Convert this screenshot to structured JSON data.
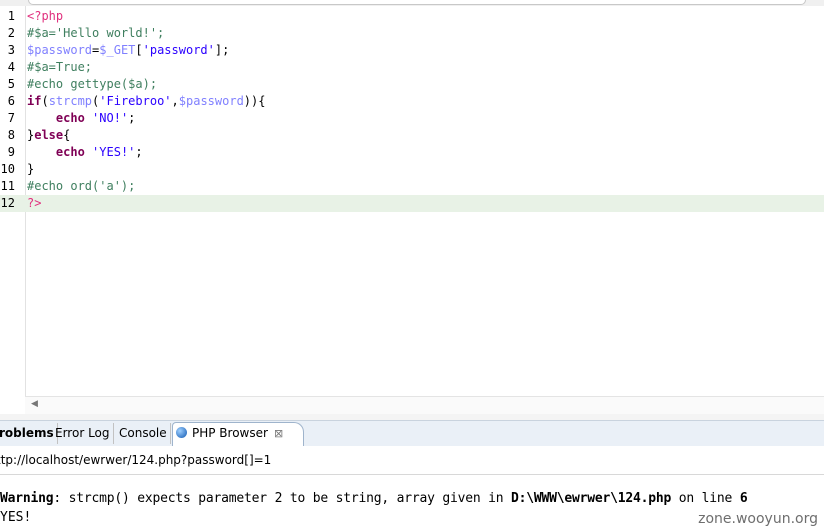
{
  "editor": {
    "line_numbers": [
      "1",
      "2",
      "3",
      "4",
      "5",
      "6",
      "7",
      "8",
      "9",
      "10",
      "11",
      "12"
    ],
    "lines": [
      [
        {
          "c": "tag",
          "t": "<?php"
        }
      ],
      [
        {
          "c": "comment",
          "t": "#$a='Hello world!';"
        }
      ],
      [
        {
          "c": "var",
          "t": "$password"
        },
        {
          "c": "plain",
          "t": "="
        },
        {
          "c": "var",
          "t": "$_GET"
        },
        {
          "c": "plain",
          "t": "["
        },
        {
          "c": "str",
          "t": "'password'"
        },
        {
          "c": "plain",
          "t": "];"
        }
      ],
      [
        {
          "c": "comment",
          "t": "#$a=True;"
        }
      ],
      [
        {
          "c": "comment",
          "t": "#echo gettype($a);"
        }
      ],
      [
        {
          "c": "kw",
          "t": "if"
        },
        {
          "c": "plain",
          "t": "("
        },
        {
          "c": "var",
          "t": "strcmp"
        },
        {
          "c": "plain",
          "t": "("
        },
        {
          "c": "str",
          "t": "'Firebroo'"
        },
        {
          "c": "plain",
          "t": ","
        },
        {
          "c": "var",
          "t": "$password"
        },
        {
          "c": "plain",
          "t": ")){"
        }
      ],
      [
        {
          "c": "plain",
          "t": "    "
        },
        {
          "c": "kw",
          "t": "echo"
        },
        {
          "c": "plain",
          "t": " "
        },
        {
          "c": "str",
          "t": "'NO!'"
        },
        {
          "c": "plain",
          "t": ";"
        }
      ],
      [
        {
          "c": "plain",
          "t": "}"
        },
        {
          "c": "kw",
          "t": "else"
        },
        {
          "c": "plain",
          "t": "{"
        }
      ],
      [
        {
          "c": "plain",
          "t": "    "
        },
        {
          "c": "kw",
          "t": "echo"
        },
        {
          "c": "plain",
          "t": " "
        },
        {
          "c": "str",
          "t": "'YES!'"
        },
        {
          "c": "plain",
          "t": ";"
        }
      ],
      [
        {
          "c": "plain",
          "t": "}"
        }
      ],
      [
        {
          "c": "comment",
          "t": "#echo ord('a');"
        }
      ],
      [
        {
          "c": "tag",
          "t": "?>"
        }
      ]
    ],
    "current_line": 12
  },
  "tabs": [
    {
      "label": "roblems",
      "active": false
    },
    {
      "label": "Error Log",
      "active": false
    },
    {
      "label": "Console",
      "active": false
    },
    {
      "label": "PHP Browser",
      "active": true,
      "icon": "globe-icon",
      "closable": true
    }
  ],
  "close_glyph": "⊠",
  "url": "ttp://localhost/ewrwer/124.php?password[]=1",
  "output": {
    "warning_label": "Warning",
    "warning_text": ": strcmp() expects parameter 2 to be string, array given in ",
    "warning_path": "D:\\WWW\\ewrwer\\124.php",
    "warning_mid": " on line ",
    "warning_line": "6",
    "result": "YES!"
  },
  "watermark": "zone.wooyun.org",
  "scroll_arrow": "◀"
}
